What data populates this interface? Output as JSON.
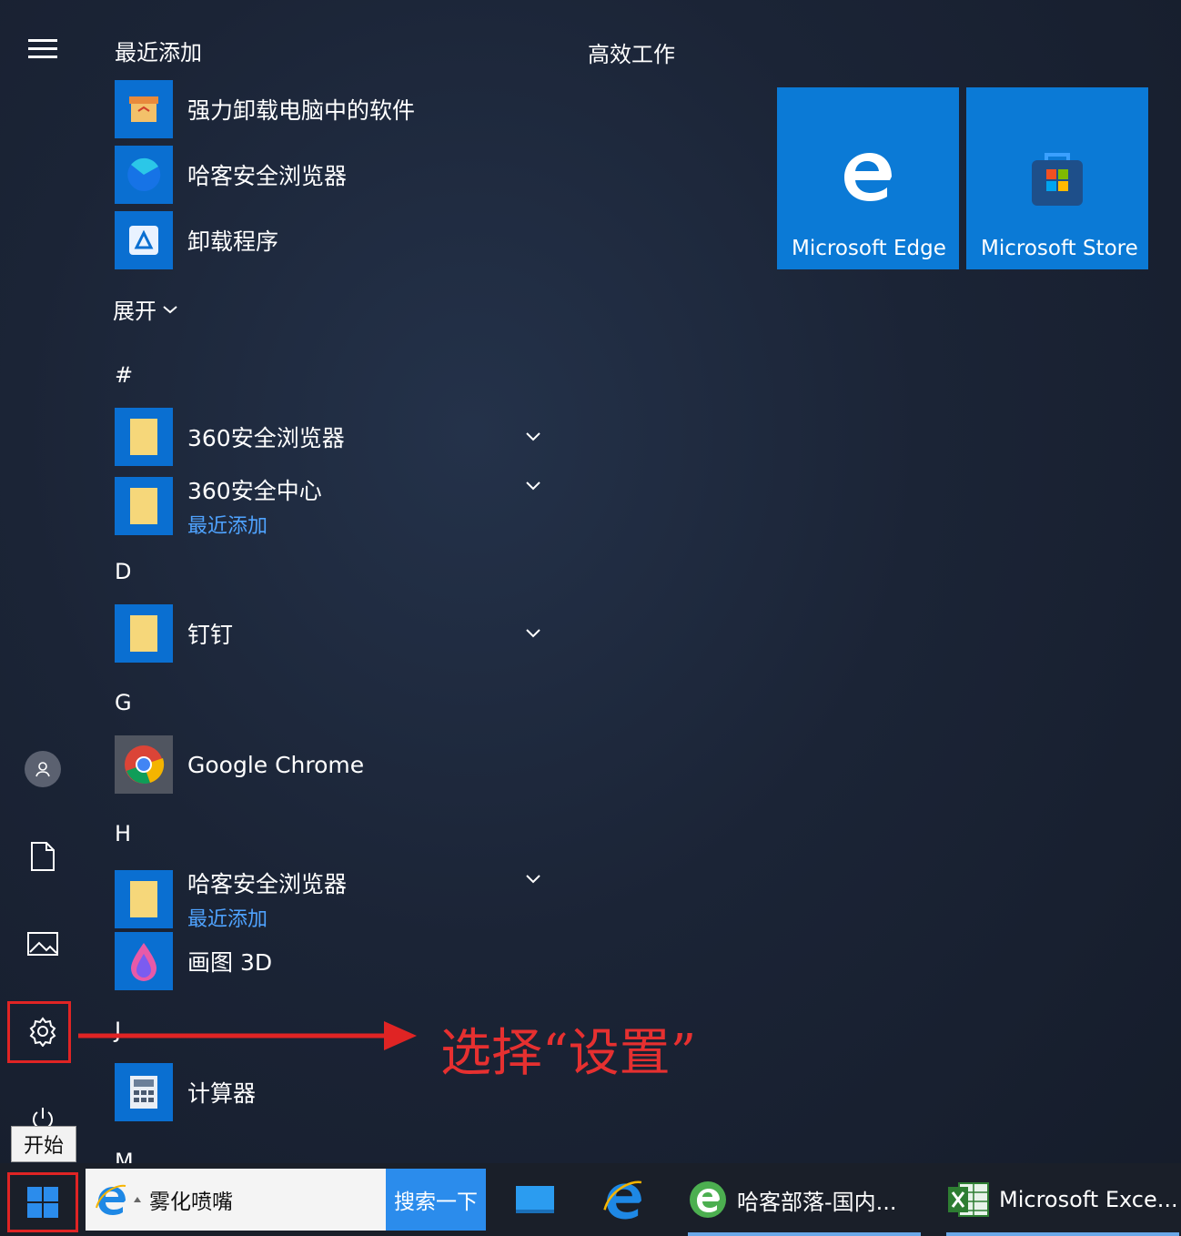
{
  "start_menu": {
    "recent_title": "最近添加",
    "productivity_title": "高效工作",
    "recent_apps": [
      {
        "name": "强力卸载电脑中的软件",
        "icon": "uninstall-box-icon"
      },
      {
        "name": "哈客安全浏览器",
        "icon": "browser-icon"
      },
      {
        "name": "卸载程序",
        "icon": "uninstall-icon"
      }
    ],
    "expand_label": "展开",
    "groups": [
      {
        "letter": "#"
      },
      {
        "letter": "D"
      },
      {
        "letter": "G"
      },
      {
        "letter": "H"
      },
      {
        "letter": "J"
      },
      {
        "letter": "M"
      }
    ],
    "apps": {
      "app_360_browser": "360安全浏览器",
      "app_360_center": "360安全中心",
      "app_360_center_sub": "最近添加",
      "dingtalk": "钉钉",
      "chrome": "Google Chrome",
      "haike_browser": "哈客安全浏览器",
      "haike_browser_sub": "最近添加",
      "paint3d": "画图 3D",
      "calculator": "计算器"
    },
    "tiles": [
      {
        "label": "Microsoft Edge",
        "icon": "edge-icon"
      },
      {
        "label": "Microsoft Store",
        "icon": "store-icon"
      }
    ],
    "start_tooltip": "开始"
  },
  "annotation": {
    "text": "选择“设置”",
    "color": "#e63030"
  },
  "taskbar": {
    "search_text": "雾化喷嘴",
    "search_button": "搜索一下",
    "items": [
      {
        "label": "",
        "icon": "desktop-icon"
      },
      {
        "label": "",
        "icon": "ie-icon"
      },
      {
        "label": "哈客部落-国内...",
        "icon": "haike-browser-icon"
      },
      {
        "label": "Microsoft Exce...",
        "icon": "excel-icon"
      }
    ]
  },
  "colors": {
    "accent": "#0a6fd1",
    "highlight": "#e02424",
    "subtext": "#4fa3ff"
  }
}
